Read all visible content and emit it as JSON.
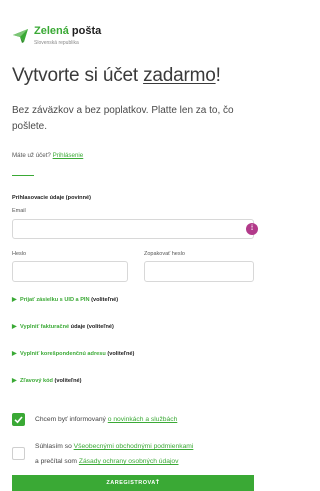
{
  "brand": {
    "name_part1": "Zelená",
    "name_part2": "pošta",
    "subtitle": "Slovenská republika",
    "logo_icon": "envelope-leaf-icon",
    "accent": "#3aa935"
  },
  "heading": {
    "prefix": "Vytvorte si účet ",
    "emphasis": "zadarmo",
    "suffix": "!"
  },
  "intro": "Bez záväzkov a bez poplatkov. Platte len za to, čo pošlete.",
  "login": {
    "prompt": "Máte už účet?",
    "link": "Prihlásenie"
  },
  "section": {
    "title": "Prihlasovacie údaje (povinné)"
  },
  "fields": {
    "email_label": "Email",
    "email_value": "",
    "password_label": "Heslo",
    "password_value": "",
    "confirm_label": "Zopakovať heslo",
    "confirm_value": ""
  },
  "expanders": [
    {
      "link": "Prijať zásielku s UID a PIN",
      "note": "(voliteľné)"
    },
    {
      "link": "Vyplniť fakturačné",
      "plain": " údaje",
      "note": "(voliteľné)"
    },
    {
      "link": "Vyplniť korešpondenčnú adresu",
      "note": "(voliteľné)"
    },
    {
      "link": "Zľavový kód",
      "note": "(voliteľné)"
    }
  ],
  "consents": {
    "newsletter_prefix": "Chcem byť informovaný ",
    "newsletter_link": "o novinkách a službách",
    "newsletter_checked": true,
    "terms_prefix": "Súhlasím so ",
    "terms_link": "Všeobecnými obchodnými podmienkami",
    "terms_line2_prefix": "a prečítal som ",
    "privacy_link": "Zásady ochrany osobných údajov",
    "terms_checked": false
  },
  "submit_label": "ZAREGISTROVAŤ"
}
